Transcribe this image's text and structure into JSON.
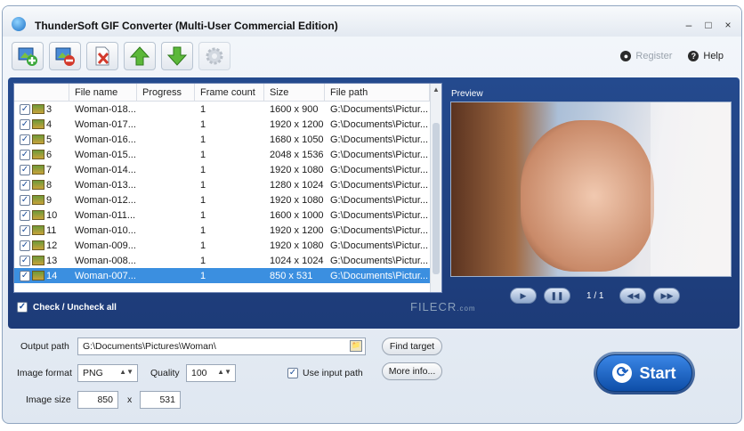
{
  "window": {
    "title": "ThunderSoft GIF Converter (Multi-User Commercial Edition)",
    "controls": [
      "–",
      "□",
      "×"
    ]
  },
  "toolbar": {
    "buttons": [
      {
        "name": "add-files",
        "icon": "add-image-icon"
      },
      {
        "name": "remove-file",
        "icon": "remove-image-icon"
      },
      {
        "name": "clear-all",
        "icon": "clear-list-icon"
      },
      {
        "name": "move-up",
        "icon": "arrow-up-icon"
      },
      {
        "name": "move-down",
        "icon": "arrow-down-icon"
      },
      {
        "name": "settings",
        "icon": "gear-icon",
        "disabled": true
      }
    ]
  },
  "header_links": {
    "register": "Register",
    "help": "Help"
  },
  "file_list": {
    "columns": [
      "",
      "File name",
      "Progress",
      "Frame count",
      "Size",
      "File path"
    ],
    "rows": [
      {
        "index": "3",
        "name": "Woman-018...",
        "progress": "",
        "frames": "1",
        "size": "1600 x 900",
        "path": "G:\\Documents\\Pictur..."
      },
      {
        "index": "4",
        "name": "Woman-017...",
        "progress": "",
        "frames": "1",
        "size": "1920 x 1200",
        "path": "G:\\Documents\\Pictur..."
      },
      {
        "index": "5",
        "name": "Woman-016...",
        "progress": "",
        "frames": "1",
        "size": "1680 x 1050",
        "path": "G:\\Documents\\Pictur..."
      },
      {
        "index": "6",
        "name": "Woman-015...",
        "progress": "",
        "frames": "1",
        "size": "2048 x 1536",
        "path": "G:\\Documents\\Pictur..."
      },
      {
        "index": "7",
        "name": "Woman-014...",
        "progress": "",
        "frames": "1",
        "size": "1920 x 1080",
        "path": "G:\\Documents\\Pictur..."
      },
      {
        "index": "8",
        "name": "Woman-013...",
        "progress": "",
        "frames": "1",
        "size": "1280 x 1024",
        "path": "G:\\Documents\\Pictur..."
      },
      {
        "index": "9",
        "name": "Woman-012...",
        "progress": "",
        "frames": "1",
        "size": "1920 x 1080",
        "path": "G:\\Documents\\Pictur..."
      },
      {
        "index": "10",
        "name": "Woman-011...",
        "progress": "",
        "frames": "1",
        "size": "1600 x 1000",
        "path": "G:\\Documents\\Pictur..."
      },
      {
        "index": "11",
        "name": "Woman-010...",
        "progress": "",
        "frames": "1",
        "size": "1920 x 1200",
        "path": "G:\\Documents\\Pictur..."
      },
      {
        "index": "12",
        "name": "Woman-009...",
        "progress": "",
        "frames": "1",
        "size": "1920 x 1080",
        "path": "G:\\Documents\\Pictur..."
      },
      {
        "index": "13",
        "name": "Woman-008...",
        "progress": "",
        "frames": "1",
        "size": "1024 x 1024",
        "path": "G:\\Documents\\Pictur..."
      },
      {
        "index": "14",
        "name": "Woman-007...",
        "progress": "",
        "frames": "1",
        "size": "850 x 531",
        "path": "G:\\Documents\\Pictur...",
        "selected": true
      }
    ]
  },
  "check_all_label": "Check / Uncheck all",
  "preview": {
    "label": "Preview",
    "page": "1 / 1"
  },
  "watermark": {
    "text": "FILECR",
    "suffix": ".com"
  },
  "output": {
    "path_label": "Output path",
    "path_value": "G:\\Documents\\Pictures\\Woman\\",
    "find_target": "Find target",
    "format_label": "Image format",
    "format_value": "PNG",
    "quality_label": "Quality",
    "quality_value": "100",
    "use_input_path": "Use input path",
    "more_info": "More info...",
    "size_label": "Image size",
    "width": "850",
    "times": "x",
    "height": "531"
  },
  "start_label": "Start",
  "colors": {
    "panel_blue": "#244a8e",
    "selected_row": "#3b8fe0",
    "start_blue": "#1a5fc0"
  }
}
